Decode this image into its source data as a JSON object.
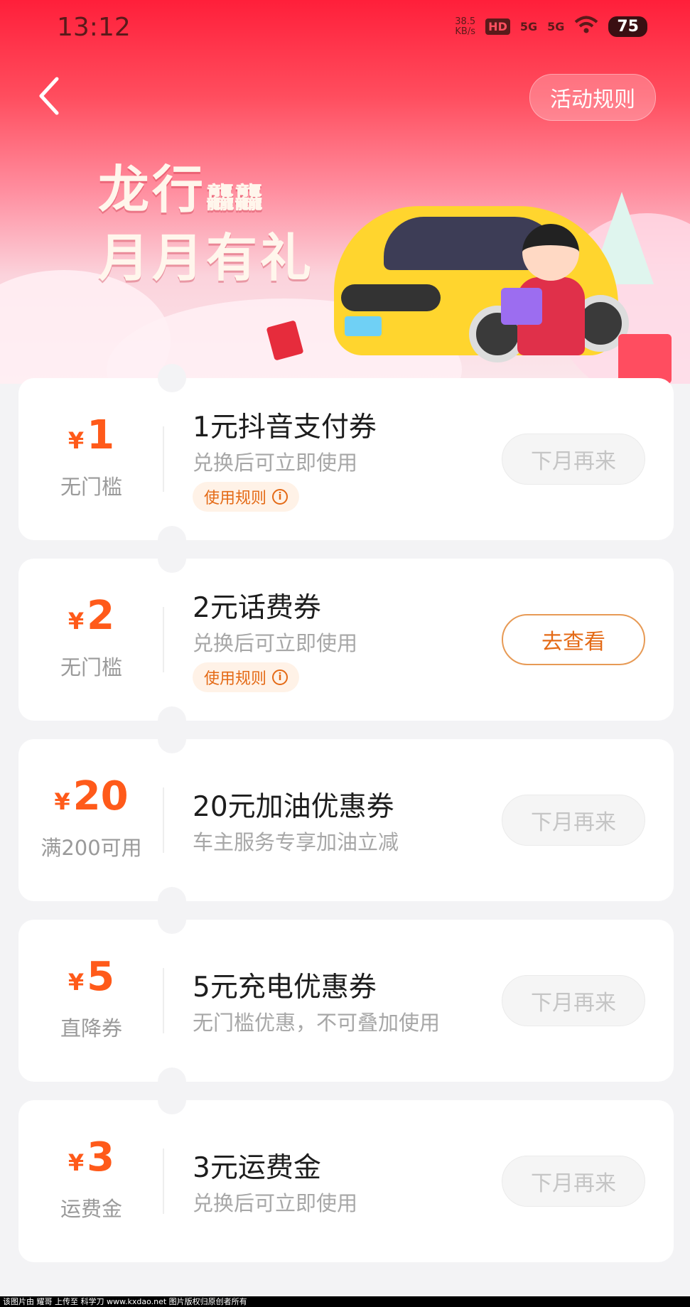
{
  "status_bar": {
    "time": "13:12",
    "net_speed_value": "38.5",
    "net_speed_unit": "KB/s",
    "hd_label": "HD",
    "signal1": "5G",
    "signal2": "5G",
    "battery": "75"
  },
  "header": {
    "rules_button": "活动规则"
  },
  "hero": {
    "title_line1": "龙行",
    "title_line1_small": "龘龘",
    "title_line2": "月月有礼"
  },
  "cards": [
    {
      "currency": "¥",
      "amount": "1",
      "condition": "无门槛",
      "title": "1元抖音支付券",
      "subtitle": "兑换后可立即使用",
      "rule_label": "使用规则",
      "button": "下月再来",
      "button_state": "disabled"
    },
    {
      "currency": "¥",
      "amount": "2",
      "condition": "无门槛",
      "title": "2元话费券",
      "subtitle": "兑换后可立即使用",
      "rule_label": "使用规则",
      "button": "去查看",
      "button_state": "active"
    },
    {
      "currency": "¥",
      "amount": "20",
      "condition": "满200可用",
      "title": "20元加油优惠券",
      "subtitle": "车主服务专享加油立减",
      "button": "下月再来",
      "button_state": "disabled"
    },
    {
      "currency": "¥",
      "amount": "5",
      "condition": "直降券",
      "title": "5元充电优惠券",
      "subtitle": "无门槛优惠，不可叠加使用",
      "button": "下月再来",
      "button_state": "disabled"
    },
    {
      "currency": "¥",
      "amount": "3",
      "condition": "运费金",
      "title": "3元运费金",
      "subtitle": "兑换后可立即使用",
      "button": "下月再来",
      "button_state": "disabled"
    }
  ],
  "footer": {
    "text": "该图片由 耀哥 上传至 科学刀 www.kxdao.net 图片版权归原创者所有"
  },
  "colors": {
    "accent": "#ff5a1a",
    "hero_top": "#ff1f3a",
    "active_border": "#e79a55"
  }
}
